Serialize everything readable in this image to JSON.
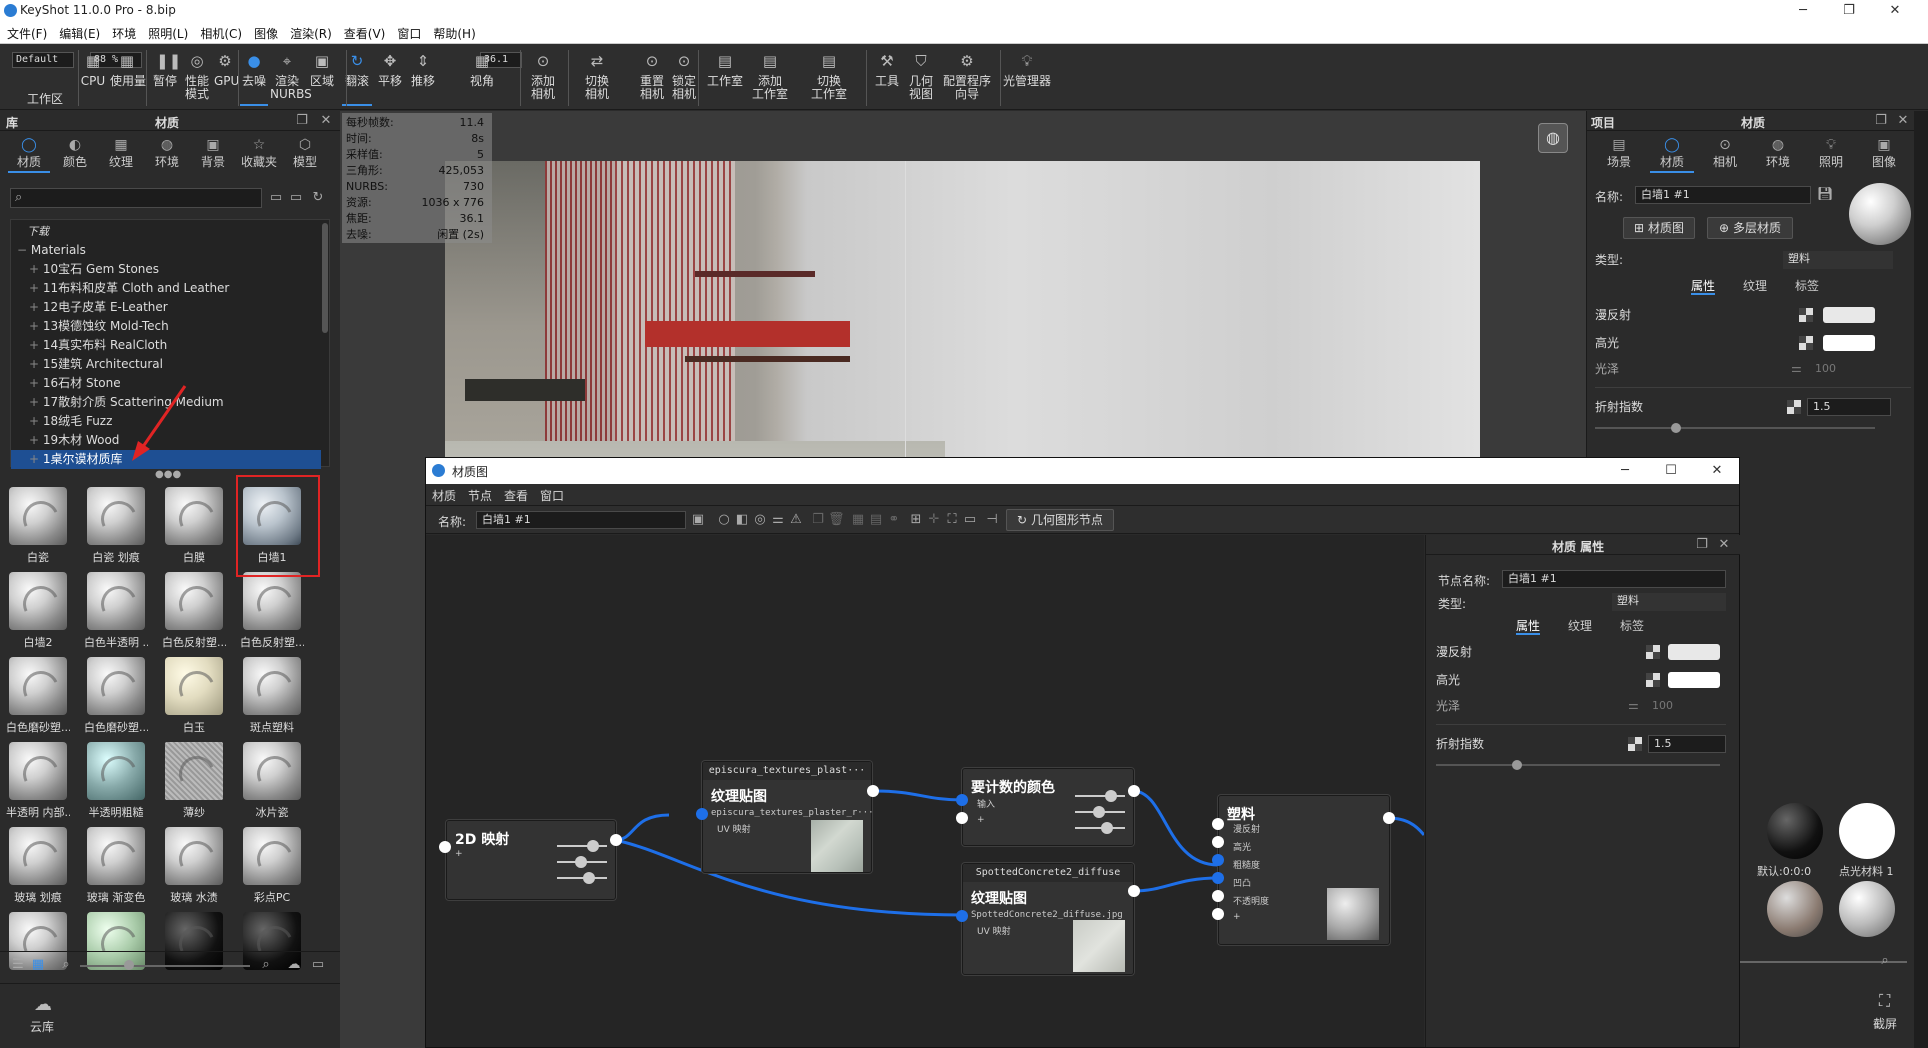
{
  "window": {
    "title": "KeyShot 11.0.0 Pro  - 8.bip"
  },
  "menu": [
    "文件(F)",
    "编辑(E)",
    "环境",
    "照明(L)",
    "相机(C)",
    "图像",
    "渲染(R)",
    "查看(V)",
    "窗口",
    "帮助(H)"
  ],
  "toolbar": {
    "default_combo": "Default",
    "zoom_combo": "88 %",
    "fov_combo": "36.1",
    "buttons": [
      {
        "label": "工作区",
        "icon": "workspace-icon"
      },
      {
        "label": "CPU",
        "icon": "cpu-icon"
      },
      {
        "label": "使用量",
        "icon": "usage-icon"
      },
      {
        "label": "暂停",
        "icon": "pause-icon"
      },
      {
        "label": "性能\n模式",
        "icon": "performance-icon"
      },
      {
        "label": "GPU",
        "icon": "gpu-icon"
      },
      {
        "label": "去噪",
        "icon": "denoise-icon"
      },
      {
        "label": "渲染\nNURBS",
        "icon": "nurbs-icon"
      },
      {
        "label": "区域",
        "icon": "region-icon"
      },
      {
        "label": "翻滚",
        "icon": "tumble-icon"
      },
      {
        "label": "平移",
        "icon": "pan-icon"
      },
      {
        "label": "推移",
        "icon": "dolly-icon"
      },
      {
        "label": "视角",
        "icon": "fov-icon"
      },
      {
        "label": "添加\n相机",
        "icon": "add-camera-icon"
      },
      {
        "label": "切换\n相机",
        "icon": "switch-camera-icon"
      },
      {
        "label": "重置\n相机",
        "icon": "reset-camera-icon"
      },
      {
        "label": "锁定\n相机",
        "icon": "lock-camera-icon"
      },
      {
        "label": "工作室",
        "icon": "studio-icon"
      },
      {
        "label": "添加\n工作室",
        "icon": "add-studio-icon"
      },
      {
        "label": "切换\n工作室",
        "icon": "switch-studio-icon"
      },
      {
        "label": "工具",
        "icon": "tools-icon"
      },
      {
        "label": "几何\n视图",
        "icon": "geometry-view-icon"
      },
      {
        "label": "配置程序\n向导",
        "icon": "configurator-icon"
      },
      {
        "label": "光管理器",
        "icon": "light-manager-icon"
      }
    ]
  },
  "library": {
    "header_left": "库",
    "header_title": "材质",
    "tabs": [
      "材质",
      "颜色",
      "纹理",
      "环境",
      "背景",
      "收藏夹",
      "模型"
    ],
    "tree": [
      {
        "label": "下载",
        "indent": 1,
        "italic": true
      },
      {
        "label": "Materials",
        "indent": 1
      },
      {
        "label": "10宝石 Gem Stones",
        "indent": 2
      },
      {
        "label": "11布料和皮革 Cloth and Leather",
        "indent": 2
      },
      {
        "label": "12电子皮革 E-Leather",
        "indent": 2
      },
      {
        "label": "13模德蚀纹 Mold-Tech",
        "indent": 2
      },
      {
        "label": "14真实布料 RealCloth",
        "indent": 2
      },
      {
        "label": "15建筑 Architectural",
        "indent": 2
      },
      {
        "label": "16石材 Stone",
        "indent": 2
      },
      {
        "label": "17散射介质 Scattering Medium",
        "indent": 2
      },
      {
        "label": "18绒毛 Fuzz",
        "indent": 2
      },
      {
        "label": "19木材 Wood",
        "indent": 2
      },
      {
        "label": "1桌尔谟材质库",
        "indent": 2,
        "selected": true
      }
    ],
    "thumbs": [
      "白瓷",
      "白瓷 划痕",
      "白膜",
      "白墙1",
      "白墙2",
      "白色半透明 ...",
      "白色反射塑...",
      "白色反射塑...",
      "白色磨砂塑...",
      "白色磨砂塑...",
      "白玉",
      "斑点塑料",
      "半透明 内部...",
      "半透明粗糙",
      "薄纱",
      "冰片瓷",
      "玻璃 划痕",
      "玻璃 渐变色",
      "玻璃 水渍",
      "彩点PC",
      "",
      "",
      "",
      ""
    ],
    "cloud": "云库"
  },
  "render_stats": [
    {
      "k": "每秒帧数:",
      "v": "11.4"
    },
    {
      "k": "时间:",
      "v": "8s"
    },
    {
      "k": "采样值:",
      "v": "5"
    },
    {
      "k": "三角形:",
      "v": "425,053"
    },
    {
      "k": "NURBS:",
      "v": "730"
    },
    {
      "k": "资源:",
      "v": "1036 x 776"
    },
    {
      "k": "焦距:",
      "v": "36.1"
    },
    {
      "k": "去噪:",
      "v": "闲置 (2s)"
    }
  ],
  "project": {
    "header_left": "项目",
    "header_title": "材质",
    "tabs": [
      "场景",
      "材质",
      "相机",
      "环境",
      "照明",
      "图像"
    ],
    "name_label": "名称:",
    "name_value": "白墙1 #1",
    "btn_graph": "材质图",
    "btn_multi": "多层材质",
    "type_label": "类型:",
    "type_value": "塑料",
    "subtabs": [
      "属性",
      "纹理",
      "标签"
    ],
    "props": {
      "diffuse": "漫反射",
      "specular": "高光",
      "roughness": "光泽",
      "roughness_value": "100",
      "ior": "折射指数",
      "ior_value": "1.5"
    },
    "fullscreen": "截屏",
    "thumbs": [
      "默认:0:0:0",
      "点光材料 1",
      "",
      ""
    ]
  },
  "graph": {
    "title": "材质图",
    "menu": [
      "材质",
      "节点",
      "查看",
      "窗口"
    ],
    "name_label": "名称:",
    "name_value": "白墙1 #1",
    "geo_btn": "几何图形节点",
    "props_title": "材质 属性",
    "node_name_label": "节点名称:",
    "node_name_value": "白墙1 #1",
    "type_label": "类型:",
    "type_value": "塑料",
    "subtabs": [
      "属性",
      "纹理",
      "标签"
    ],
    "props": {
      "diffuse": "漫反射",
      "specular": "高光",
      "roughness": "光泽",
      "roughness_value": "100",
      "ior": "折射指数",
      "ior_value": "1.5"
    },
    "nodes": {
      "map2d": {
        "title": "2D 映射"
      },
      "tex1": {
        "header": "episcura_textures_plast···",
        "title": "纹理贴图",
        "file": "episcura_textures_plaster_r···",
        "port": "UV 映射"
      },
      "color": {
        "title": "要计数的颜色",
        "p1": "输入",
        "p2": "+"
      },
      "tex2": {
        "header": "SpottedConcrete2_diffuse",
        "title": "纹理贴图",
        "file": "SpottedConcrete2_diffuse.jpg",
        "port": "UV 映射"
      },
      "plastic": {
        "title": "塑料",
        "ports": [
          "漫反射",
          "高光",
          "粗糙度",
          "凹凸",
          "不透明度",
          "+"
        ]
      }
    }
  }
}
